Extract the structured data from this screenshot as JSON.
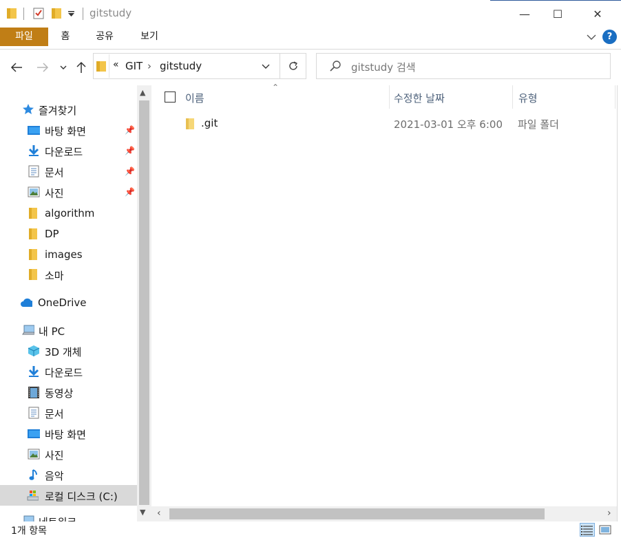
{
  "window": {
    "title": "gitstudy",
    "controls": {
      "minimize": "—",
      "maximize": "☐",
      "close": "✕"
    }
  },
  "ribbon": {
    "tabs": [
      {
        "label": "파일",
        "active": true
      },
      {
        "label": "홈"
      },
      {
        "label": "공유"
      },
      {
        "label": "보기"
      }
    ],
    "help": "?"
  },
  "address_bar": {
    "overflow": "«",
    "crumbs": [
      "GIT",
      "gitstudy"
    ],
    "separator": "›"
  },
  "search": {
    "placeholder": "gitstudy 검색"
  },
  "sidebar": {
    "quick_access": {
      "label": "즐겨찾기",
      "icon": "star-icon"
    },
    "quick_items": [
      {
        "label": "바탕 화면",
        "icon": "desktop-icon",
        "pinned": true
      },
      {
        "label": "다운로드",
        "icon": "download-icon",
        "pinned": true
      },
      {
        "label": "문서",
        "icon": "document-icon",
        "pinned": true
      },
      {
        "label": "사진",
        "icon": "picture-icon",
        "pinned": true
      },
      {
        "label": "algorithm",
        "icon": "folder-icon"
      },
      {
        "label": "DP",
        "icon": "folder-icon"
      },
      {
        "label": "images",
        "icon": "folder-icon"
      },
      {
        "label": "소마",
        "icon": "folder-icon"
      }
    ],
    "onedrive": {
      "label": "OneDrive",
      "icon": "cloud-icon"
    },
    "this_pc": {
      "label": "내 PC",
      "icon": "computer-icon"
    },
    "pc_items": [
      {
        "label": "3D 개체",
        "icon": "cube-icon"
      },
      {
        "label": "다운로드",
        "icon": "download-icon"
      },
      {
        "label": "동영상",
        "icon": "video-icon"
      },
      {
        "label": "문서",
        "icon": "document-icon"
      },
      {
        "label": "바탕 화면",
        "icon": "desktop-icon"
      },
      {
        "label": "사진",
        "icon": "picture-icon"
      },
      {
        "label": "음악",
        "icon": "music-icon"
      },
      {
        "label": "로컬 디스크 (C:)",
        "icon": "drive-icon",
        "selected": true
      }
    ],
    "network": {
      "label": "네트워크",
      "icon": "network-icon"
    }
  },
  "file_list": {
    "columns": {
      "name": "이름",
      "modified": "수정한 날짜",
      "type": "유형"
    },
    "rows": [
      {
        "name": ".git",
        "modified": "2021-03-01 오후 6:00",
        "type": "파일 폴더"
      }
    ]
  },
  "status": {
    "item_count": "1개 항목"
  },
  "colors": {
    "file_tab": "#c07e16",
    "folder": "#f3c54a",
    "accent_blue": "#1a6ec2"
  }
}
